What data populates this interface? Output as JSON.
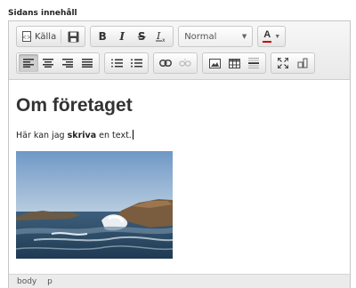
{
  "field": {
    "label": "Sidans innehåll"
  },
  "toolbar": {
    "source_label": "Källa",
    "format_value": "Normal",
    "text_color_label": "A"
  },
  "content": {
    "heading": "Om företaget",
    "para_before": "Här kan jag ",
    "para_bold": "skriva",
    "para_after": " en text."
  },
  "statusbar": {
    "path": [
      "body",
      "p"
    ]
  },
  "colors": {
    "toolbar_bg": "#ececec",
    "border": "#c6c6c6",
    "text_color_underline": "#cc0000"
  }
}
